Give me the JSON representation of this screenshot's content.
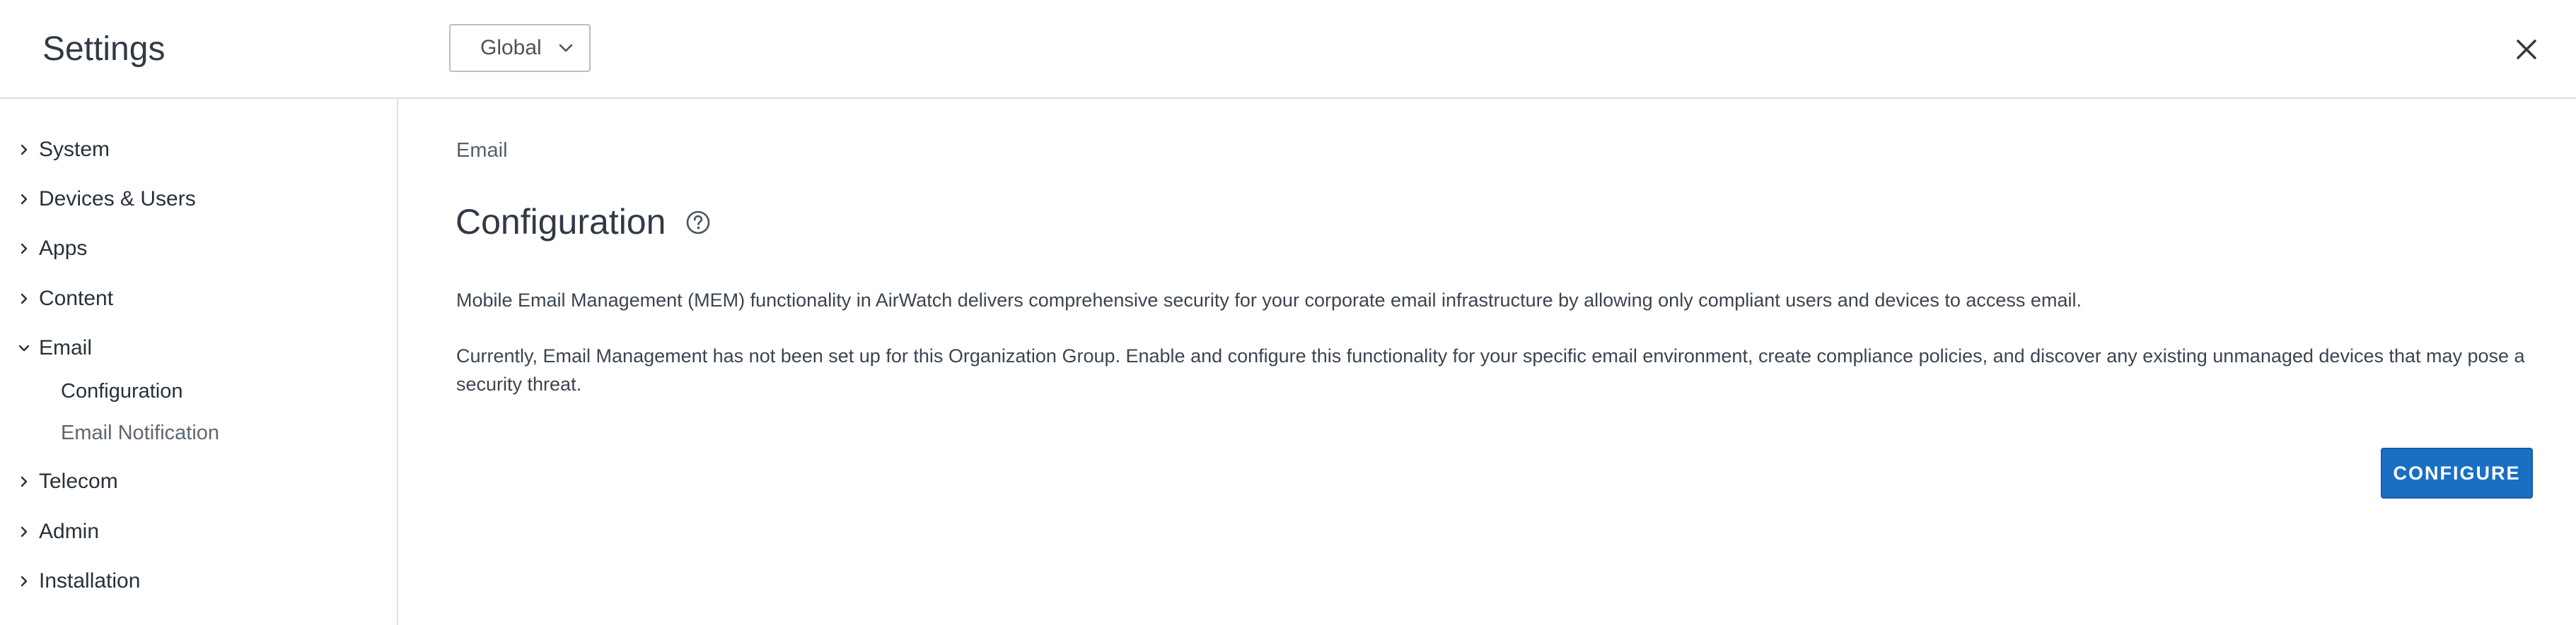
{
  "header": {
    "title": "Settings",
    "scope_selector": {
      "selected": "Global",
      "icon": "chevron-down-icon"
    },
    "close_icon": "close-icon"
  },
  "sidebar": {
    "items": [
      {
        "label": "System",
        "expanded": false
      },
      {
        "label": "Devices & Users",
        "expanded": false
      },
      {
        "label": "Apps",
        "expanded": false
      },
      {
        "label": "Content",
        "expanded": false
      },
      {
        "label": "Email",
        "expanded": true,
        "children": [
          {
            "label": "Configuration",
            "active": true
          },
          {
            "label": "Email Notification",
            "active": false
          }
        ]
      },
      {
        "label": "Telecom",
        "expanded": false
      },
      {
        "label": "Admin",
        "expanded": false
      },
      {
        "label": "Installation",
        "expanded": false
      }
    ]
  },
  "main": {
    "breadcrumb": "Email",
    "title": "Configuration",
    "help_icon": "help-circle-icon",
    "paragraphs": [
      "Mobile Email Management (MEM) functionality in AirWatch delivers comprehensive security for your corporate email infrastructure by allowing only compliant users and devices to access email.",
      "Currently, Email Management has not been set up for this Organization Group. Enable and configure this functionality for your specific email environment, create compliance policies, and discover any existing unmanaged devices that may pose a security threat."
    ],
    "configure_button": "CONFIGURE"
  },
  "colors": {
    "primary_button": "#1a6fc4",
    "divider": "#dcdfe3",
    "text": "#333d47"
  }
}
